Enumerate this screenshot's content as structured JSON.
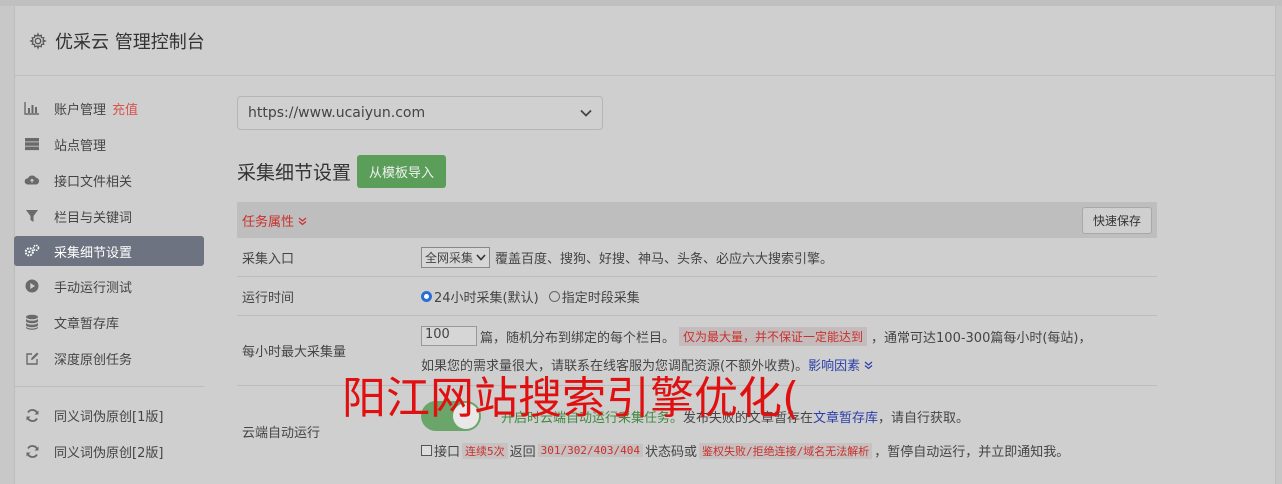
{
  "header": {
    "title": "优采云 管理控制台"
  },
  "sidebar": {
    "items": [
      {
        "label": "账户管理",
        "extra": "充值",
        "icon": "bar-chart-icon"
      },
      {
        "label": "站点管理",
        "icon": "server-icon"
      },
      {
        "label": "接口文件相关",
        "icon": "cloud-icon"
      },
      {
        "label": "栏目与关键词",
        "icon": "filter-icon"
      },
      {
        "label": "采集细节设置",
        "icon": "cogs-icon",
        "active": true
      },
      {
        "label": "手动运行测试",
        "icon": "play-icon"
      },
      {
        "label": "文章暂存库",
        "icon": "database-icon"
      },
      {
        "label": "深度原创任务",
        "icon": "edit-icon"
      },
      {
        "label": "同义词伪原创[1版]",
        "icon": "refresh-icon"
      },
      {
        "label": "同义词伪原创[2版]",
        "icon": "refresh-icon"
      }
    ]
  },
  "main": {
    "site_select": "https://www.ucaiyun.com",
    "section_title": "采集细节设置",
    "import_button": "从模板导入",
    "task_attr": "任务属性",
    "quick_save": "快速保存",
    "rows": {
      "entry": {
        "label": "采集入口",
        "select": "全网采集",
        "desc": "覆盖百度、搜狗、好搜、神马、头条、必应六大搜索引擎。"
      },
      "runtime": {
        "label": "运行时间",
        "opt1": "24小时采集(默认)",
        "opt2": "指定时段采集"
      },
      "max": {
        "label": "每小时最大采集量",
        "value": "100",
        "t1": "篇，随机分布到绑定的每个栏目。",
        "tag": "仅为最大量，并不保证一定能达到",
        "t2": "，通常可达100-300篇每小时(每站)，",
        "t3": "如果您的需求量很大，请联系在线客服为您调配资源(不额外收费)。",
        "link": "影响因素"
      },
      "cloud": {
        "label": "云端自动运行",
        "green": "开启时云端自动运行采集任务。",
        "t1": "发布失败的文章暂存在",
        "link": "文章暂存库",
        "t2": "，请自行获取。",
        "cb_label": "接口",
        "c1": "连续5次",
        "t3": "返回",
        "c2": "301/302/403/404",
        "t4": "状态码或",
        "c3": "鉴权失败/拒绝连接/域名无法解析",
        "t5": "，暂停自动运行，并立即通知我。"
      }
    }
  },
  "overlay_text": "阳江网站搜索引擎优化("
}
